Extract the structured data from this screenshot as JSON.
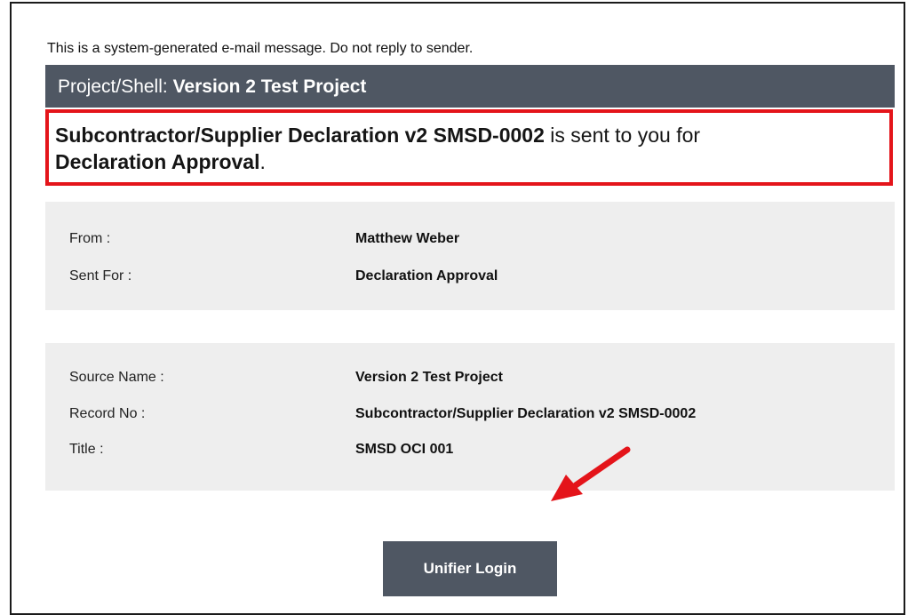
{
  "email": {
    "notice": "This is a system-generated e-mail message. Do not reply to sender.",
    "header": {
      "label": "Project/Shell: ",
      "value": "Version 2 Test Project"
    },
    "headline": {
      "record": "Subcontractor/Supplier Declaration v2 SMSD-0002",
      "middle": " is sent to you for ",
      "action": "Declaration Approval",
      "end": "."
    },
    "details_1": {
      "from_label": "From :",
      "from_value": "Matthew Weber",
      "sent_for_label": "Sent For :",
      "sent_for_value": "Declaration Approval"
    },
    "details_2": {
      "source_name_label": "Source Name :",
      "source_name_value": "Version 2 Test Project",
      "record_no_label": "Record No :",
      "record_no_value": "Subcontractor/Supplier Declaration v2 SMSD-0002",
      "title_label": "Title :",
      "title_value": "SMSD OCI 001"
    },
    "login_button": "Unifier Login"
  },
  "colors": {
    "header_bg": "#4f5763",
    "highlight_border": "#e4141a",
    "panel_bg": "#eeeeee",
    "arrow": "#e4141a"
  },
  "annotation": {
    "icon": "red-arrow-icon"
  }
}
